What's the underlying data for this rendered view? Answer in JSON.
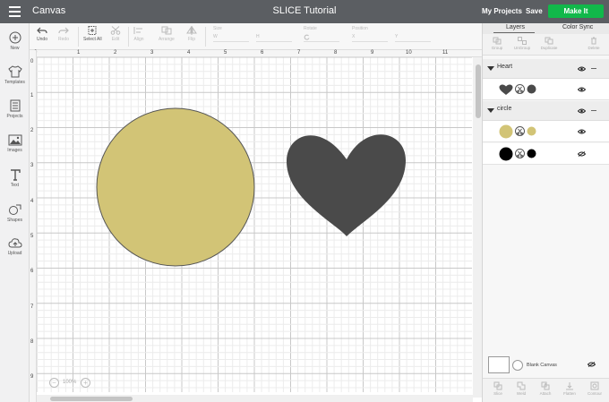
{
  "topbar": {
    "app_title": "Canvas",
    "document_title": "SLICE Tutorial",
    "my_projects": "My Projects",
    "save": "Save",
    "make_it": "Make It"
  },
  "leftbar": {
    "items": [
      {
        "label": "New",
        "icon": "plus-circle-icon"
      },
      {
        "label": "Templates",
        "icon": "shirt-icon"
      },
      {
        "label": "Projects",
        "icon": "projects-icon"
      },
      {
        "label": "Images",
        "icon": "image-icon"
      },
      {
        "label": "Text",
        "icon": "text-icon"
      },
      {
        "label": "Shapes",
        "icon": "shapes-icon"
      },
      {
        "label": "Upload",
        "icon": "cloud-upload-icon"
      }
    ]
  },
  "toolbar": {
    "undo": "Undo",
    "redo": "Redo",
    "select_all": "Select All",
    "edit": "Edit",
    "align": "Align",
    "arrange": "Arrange",
    "flip": "Flip",
    "size": "Size",
    "w": "W",
    "h": "H",
    "rotate": "Rotate",
    "position": "Position",
    "x": "X",
    "y": "Y"
  },
  "rulers": {
    "top": [
      "0",
      "1",
      "2",
      "3",
      "4",
      "5",
      "6",
      "7",
      "8",
      "9",
      "10",
      "11"
    ],
    "left": [
      "0",
      "1",
      "2",
      "3",
      "4",
      "5",
      "6",
      "7",
      "8",
      "9"
    ]
  },
  "zoom": {
    "value": "100%",
    "minus": "−",
    "plus": "+"
  },
  "panel": {
    "tabs": [
      "Layers",
      "Color Sync"
    ],
    "tools": [
      "Group",
      "UnGroup",
      "Duplicate",
      "Delete"
    ],
    "groups": [
      {
        "name": "Heart"
      },
      {
        "name": "circle"
      }
    ],
    "blank_canvas": "Blank Canvas",
    "bottom_tools": [
      "Slice",
      "Weld",
      "Attach",
      "Flatten",
      "Contour"
    ]
  },
  "colors": {
    "circle_fill": "#d2c476",
    "heart_fill": "#4a4a4a",
    "black": "#000000",
    "make_it": "#11b84a",
    "topbar": "#5b5e62"
  }
}
